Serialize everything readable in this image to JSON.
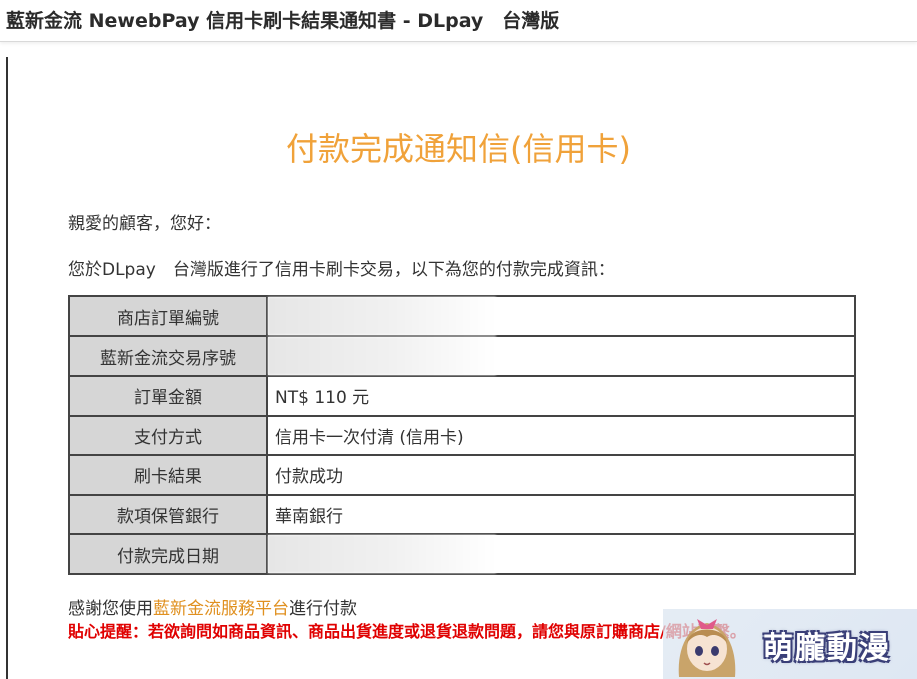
{
  "window": {
    "title": "藍新金流 NewebPay 信用卡刷卡結果通知書 - DLpay　台灣版"
  },
  "email": {
    "heading": "付款完成通知信(信用卡)",
    "greeting": "親愛的顧客，您好：",
    "intro": "您於DLpay　台灣版進行了信用卡刷卡交易，以下為您的付款完成資訊：",
    "rows": [
      {
        "label": "商店訂單編號",
        "value": ""
      },
      {
        "label": "藍新金流交易序號",
        "value": ""
      },
      {
        "label": "訂單金額",
        "value": "NT$ 110 元"
      },
      {
        "label": "支付方式",
        "value": "信用卡一次付清 (信用卡)"
      },
      {
        "label": "刷卡結果",
        "value": "付款成功"
      },
      {
        "label": "款項保管銀行",
        "value": "華南銀行"
      },
      {
        "label": "付款完成日期",
        "value": ""
      }
    ],
    "thanks_prefix": "感謝您使用",
    "thanks_link": "藍新金流服務平台",
    "thanks_suffix": "進行付款",
    "notice": "貼心提醒：若欲詢問如商品資訊、商品出貨進度或退貨退款問題，請您與原訂購商店/網站聯繫。"
  },
  "watermark": {
    "text": "萌朧動漫"
  },
  "colors": {
    "heading": "#f0a23a",
    "link": "#e0901f",
    "notice": "#e00000",
    "label_bg": "#d6d6d6"
  }
}
